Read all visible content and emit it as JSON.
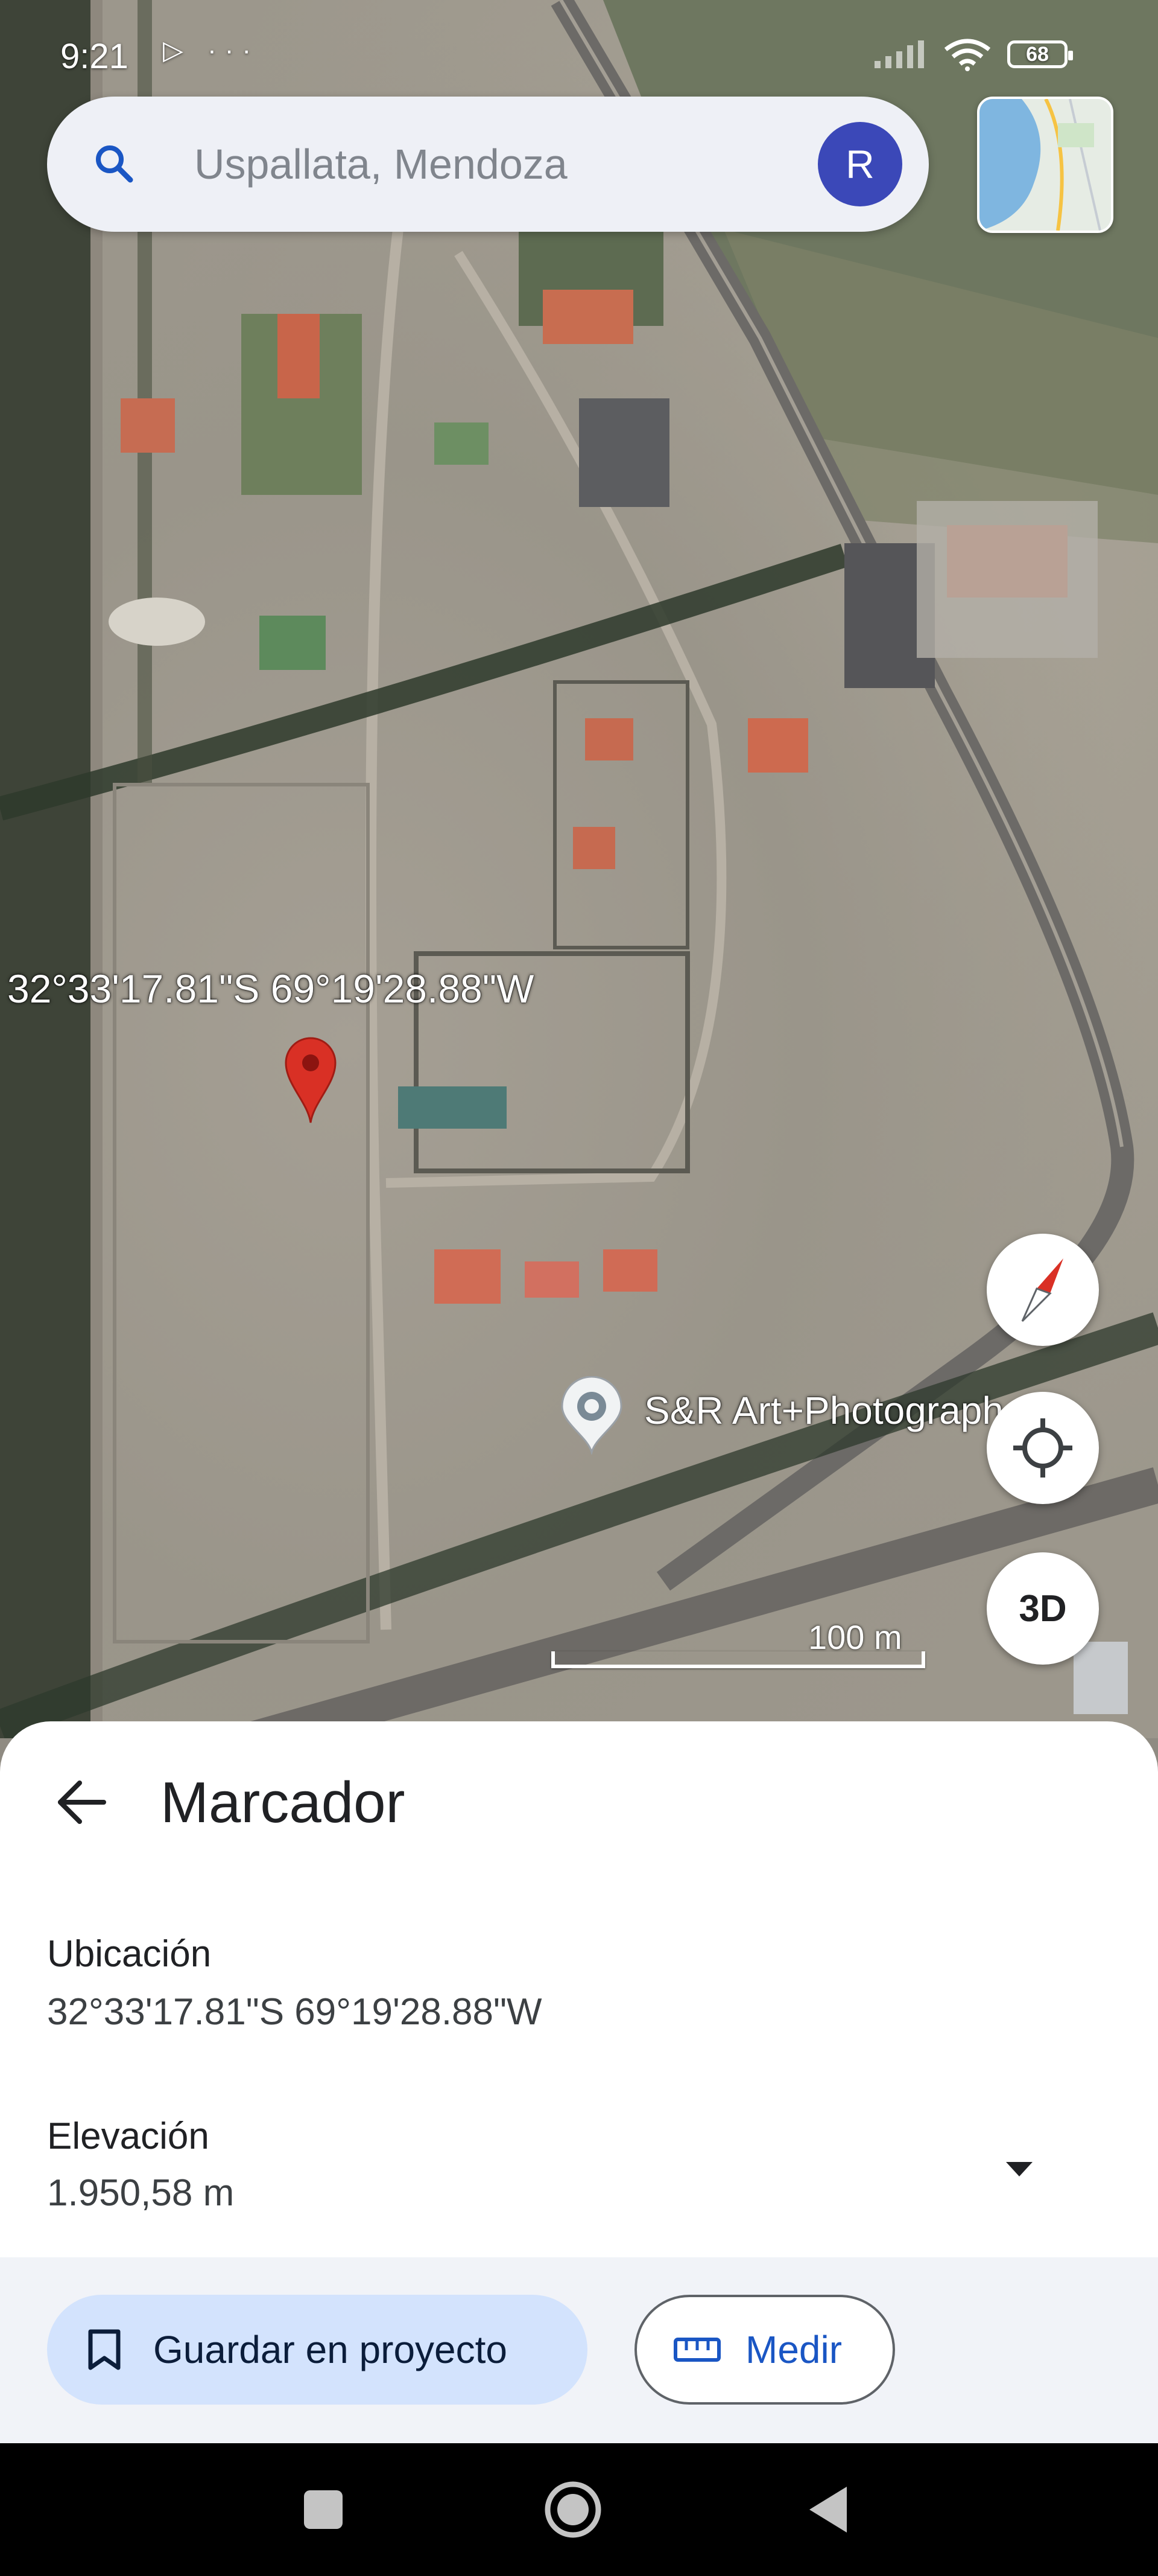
{
  "status_bar": {
    "time": "9:21",
    "left_icons": "▷ ···",
    "battery": "68"
  },
  "search": {
    "text": "Uspallata, Mendoza",
    "avatar_letter": "R"
  },
  "map": {
    "pin_coordinates": "32°33'17.81\"S 69°19'28.88\"W",
    "poi_name": "S&R Art+Photograph",
    "scale_label": "100 m",
    "button_3d": "3D"
  },
  "sheet": {
    "title": "Marcador",
    "location_label": "Ubicación",
    "location_value": "32°33'17.81\"S 69°19'28.88\"W",
    "elevation_label": "Elevación",
    "elevation_value": "1.950,58 m",
    "save_button": "Guardar en proyecto",
    "measure_button": "Medir"
  },
  "colors": {
    "accent_blue": "#1a56c4",
    "save_button_bg": "#d3e3fd",
    "avatar_bg": "#3b48b8",
    "pin_red": "#d93025"
  }
}
